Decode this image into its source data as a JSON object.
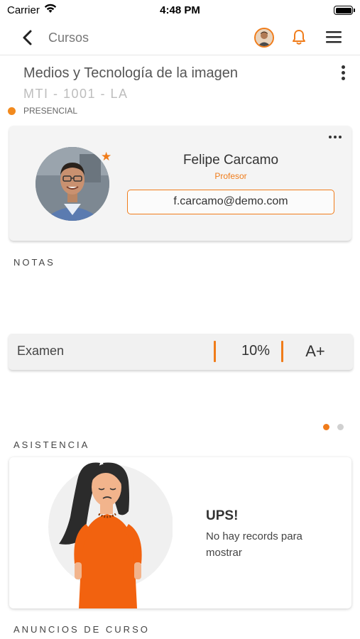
{
  "status_bar": {
    "carrier": "Carrier",
    "time": "4:48 PM"
  },
  "nav": {
    "title": "Cursos",
    "icons": [
      "back-arrow-icon",
      "avatar",
      "bell-icon",
      "hamburger-menu-icon"
    ],
    "accent_color": "#f07c1a"
  },
  "course": {
    "title": "Medios y Tecnología de la imagen",
    "code": "MTI - 1001 - LA",
    "modality": "PRESENCIAL",
    "modality_color": "#f28a1e"
  },
  "teacher": {
    "name": "Felipe Carcamo",
    "role": "Profesor",
    "email": "f.carcamo@demo.com"
  },
  "sections": {
    "grades": "NOTAS",
    "attendance": "ASISTENCIA",
    "announcements": "ANUNCIOS DE CURSO"
  },
  "grades": [
    {
      "name": "Examen",
      "weight": "10%",
      "grade": "A+"
    }
  ],
  "pager": {
    "pages": 2,
    "active": 1
  },
  "attendance": {
    "empty_title": "UPS!",
    "empty_message": "No hay records para mostrar"
  }
}
